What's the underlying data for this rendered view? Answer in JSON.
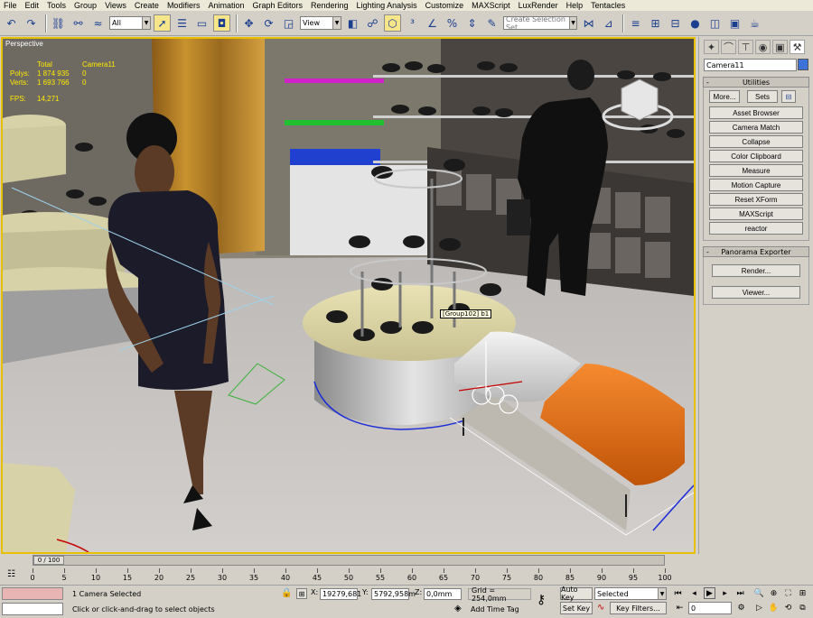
{
  "menu": [
    "File",
    "Edit",
    "Tools",
    "Group",
    "Views",
    "Create",
    "Modifiers",
    "Animation",
    "Graph Editors",
    "Rendering",
    "Lighting Analysis",
    "Customize",
    "MAXScript",
    "LuxRender",
    "Help",
    "Tentacles"
  ],
  "toolbar": {
    "filter_value": "All",
    "ref_coord_value": "View",
    "selection_set_placeholder": "Create Selection Set"
  },
  "viewport": {
    "label": "Perspective",
    "stats": {
      "header": "Total",
      "camera": "Camera11",
      "polys_label": "Polys:",
      "polys_total": "1 874 935",
      "polys_sel": "0",
      "verts_label": "Verts:",
      "verts_total": "1 693 766",
      "verts_sel": "0",
      "fps_label": "FPS:",
      "fps_value": "14,271"
    },
    "tooltip": "[Group102] b1"
  },
  "command_panel": {
    "object_name": "Camera11",
    "name_color": "#3d73d8",
    "utilities": {
      "title": "Utilities",
      "sign": "-",
      "more_label": "More...",
      "sets_label": "Sets",
      "buttons": [
        "Asset Browser",
        "Camera Match",
        "Collapse",
        "Color Clipboard",
        "Measure",
        "Motion Capture",
        "Reset XForm",
        "MAXScript",
        "reactor"
      ]
    },
    "panorama": {
      "title": "Panorama Exporter",
      "sign": "-",
      "render_label": "Render...",
      "viewer_label": "Viewer..."
    }
  },
  "timeline": {
    "frame_display": "0 / 100",
    "ticks": [
      "0",
      "5",
      "10",
      "15",
      "20",
      "25",
      "30",
      "35",
      "40",
      "45",
      "50",
      "55",
      "60",
      "65",
      "70",
      "75",
      "80",
      "85",
      "90",
      "95",
      "100"
    ]
  },
  "status": {
    "selection_text": "1 Camera Selected",
    "prompt_text": "Click or click-and-drag to select objects",
    "x_label": "X:",
    "x_value": "19279,681",
    "y_label": "Y:",
    "y_value": "5792,958m",
    "z_label": "Z:",
    "z_value": "0,0mm",
    "grid_text": "Grid = 254,0mm",
    "add_time_tag": "Add Time Tag",
    "auto_key": "Auto Key",
    "set_key": "Set Key",
    "key_mode_value": "Selected",
    "key_filters": "Key Filters...",
    "current_frame": "0"
  },
  "colors": {
    "active_viewport_border": "#e8c000",
    "stats_text": "#ffea00",
    "bench_cushion": "#e06a10",
    "shelf_magenta": "#d020c8",
    "shelf_green": "#20c030",
    "shelf_blue": "#2040d0"
  }
}
